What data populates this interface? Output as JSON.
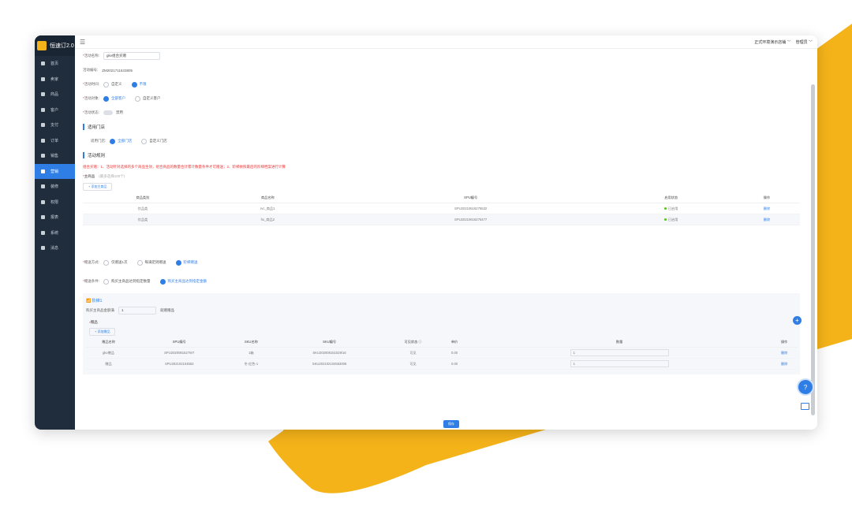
{
  "app": {
    "title": "恒速订2.0"
  },
  "sidebar": {
    "items": [
      {
        "label": "首页"
      },
      {
        "label": "卖家"
      },
      {
        "label": "商品"
      },
      {
        "label": "客户"
      },
      {
        "label": "支付"
      },
      {
        "label": "订单"
      },
      {
        "label": "销售"
      },
      {
        "label": "营销"
      },
      {
        "label": "装修"
      },
      {
        "label": "权限"
      },
      {
        "label": "报表"
      },
      {
        "label": "系统"
      },
      {
        "label": "消息"
      }
    ],
    "active_index": 7
  },
  "topbar": {
    "store": "正式环境演示店铺 ﹀",
    "user": "管理员 ﹀"
  },
  "form": {
    "name_label": "活动名称:",
    "name_value": "gkv组合买赠",
    "code_label": "活动编号:",
    "code_value": "ZM2021711633805",
    "time_label": "活动时间:",
    "time_opt1": "自定义",
    "time_opt2": "不限",
    "target_label": "活动对象:",
    "target_opt1": "全部客户",
    "target_opt2": "自定义客户",
    "status_label": "活动状态:",
    "status_value": "禁用"
  },
  "store_section": {
    "title": "适用门店",
    "label": "适用门店:",
    "opt1": "全部门店",
    "opt2": "自定义门店"
  },
  "rule_section": {
    "title": "活动规则",
    "note": "组合买赠：1、活动针对选择的多个商品生效，组合商品的数量合计累计数量条件才可赠送；2、阶梯依照最后的阶梯档案进行计算",
    "main_label": "主商品",
    "main_hint": "(最多选择100个)",
    "add_main": "+ 添加主商品"
  },
  "main_table": {
    "headers": [
      "商品类别",
      "商品名称",
      "SPU编号",
      "启用状态",
      "操作"
    ],
    "rows": [
      [
        "饮品类",
        "Ivc_商品1",
        "SPU20210616275532",
        "已启用",
        "删除"
      ],
      [
        "饮品类",
        "hx_商品2",
        "SPU20210616275477",
        "已启用",
        "删除"
      ]
    ]
  },
  "gift": {
    "mode_label": "赠送方式:",
    "mode_opt1": "仅赠送1次",
    "mode_opt2": "每满足则赠送",
    "mode_opt3": "阶梯赠送",
    "cond_label": "赠送条件:",
    "cond_opt1": "购买主商品达到指定数量",
    "cond_opt2": "购买主商品达到指定金额"
  },
  "tier": {
    "title": "阶梯1",
    "qty_label": "购买主商品金额满",
    "qty_value": "1",
    "qty_suffix": "就赠赠品",
    "gift_label": "赠品",
    "add_gift": "+ 添加赠品",
    "headers": [
      "赠品名称",
      "SPU编号",
      "SKU名称",
      "SKU编号",
      "可见状态 ⓘ",
      "单价",
      "数量",
      "操作"
    ],
    "rows": [
      [
        "gkv赠品",
        "SPU2020081527W7",
        "1箱",
        "SKU202008151529/16",
        "可见",
        "0.00",
        "1",
        "删除"
      ],
      [
        "赠品",
        "SPU202102104553",
        "冬-红色-1",
        "SKU202102104553006",
        "可见",
        "0.00",
        "1",
        "删除"
      ]
    ]
  },
  "save_label": "保存"
}
